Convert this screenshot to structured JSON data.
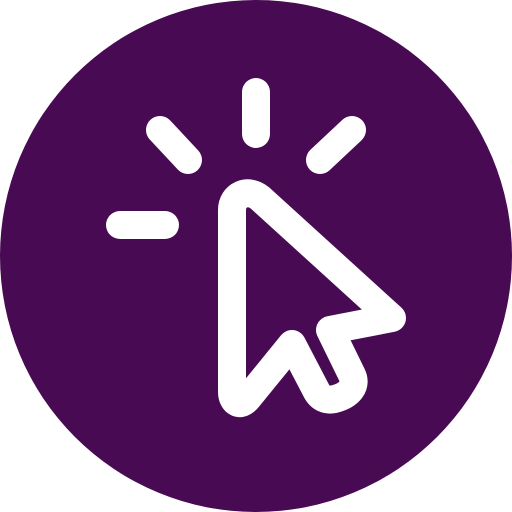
{
  "icon": {
    "name": "click-cursor-icon",
    "colors": {
      "background": "#480A52",
      "foreground": "#FFFFFF"
    }
  }
}
